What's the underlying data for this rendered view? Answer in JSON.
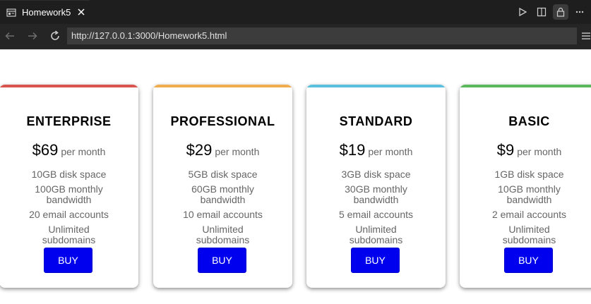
{
  "browser": {
    "tab_title": "Homework5",
    "url": "http://127.0.0.1:3000/Homework5.html",
    "icons": {
      "tab": "browser-tab-icon",
      "close": "close-icon",
      "run": "play-icon",
      "split": "split-editor-icon",
      "lock": "lock-icon",
      "more": "more-icon",
      "back": "back-arrow-icon",
      "forward": "forward-arrow-icon",
      "reload": "reload-icon",
      "menu": "menu-icon"
    }
  },
  "plans": [
    {
      "name": "ENTERPRISE",
      "price": "$69",
      "period": "per month",
      "accent": "#d9534f",
      "features": [
        "10GB disk space",
        "100GB monthly bandwidth",
        "20 email accounts",
        "Unlimited subdomains"
      ],
      "button": "BUY"
    },
    {
      "name": "PROFESSIONAL",
      "price": "$29",
      "period": "per month",
      "accent": "#f0ad4e",
      "features": [
        "5GB disk space",
        "60GB monthly bandwidth",
        "10 email accounts",
        "Unlimited subdomains"
      ],
      "button": "BUY"
    },
    {
      "name": "STANDARD",
      "price": "$19",
      "period": "per month",
      "accent": "#5bc0de",
      "features": [
        "3GB disk space",
        "30GB monthly bandwidth",
        "5 email accounts",
        "Unlimited subdomains"
      ],
      "button": "BUY"
    },
    {
      "name": "BASIC",
      "price": "$9",
      "period": "per month",
      "accent": "#5cb85c",
      "features": [
        "1GB disk space",
        "10GB monthly bandwidth",
        "2 email accounts",
        "Unlimited subdomains"
      ],
      "button": "BUY"
    }
  ],
  "colors": {
    "button": "#0000ee",
    "chrome_dark": "#1e1e1e"
  }
}
